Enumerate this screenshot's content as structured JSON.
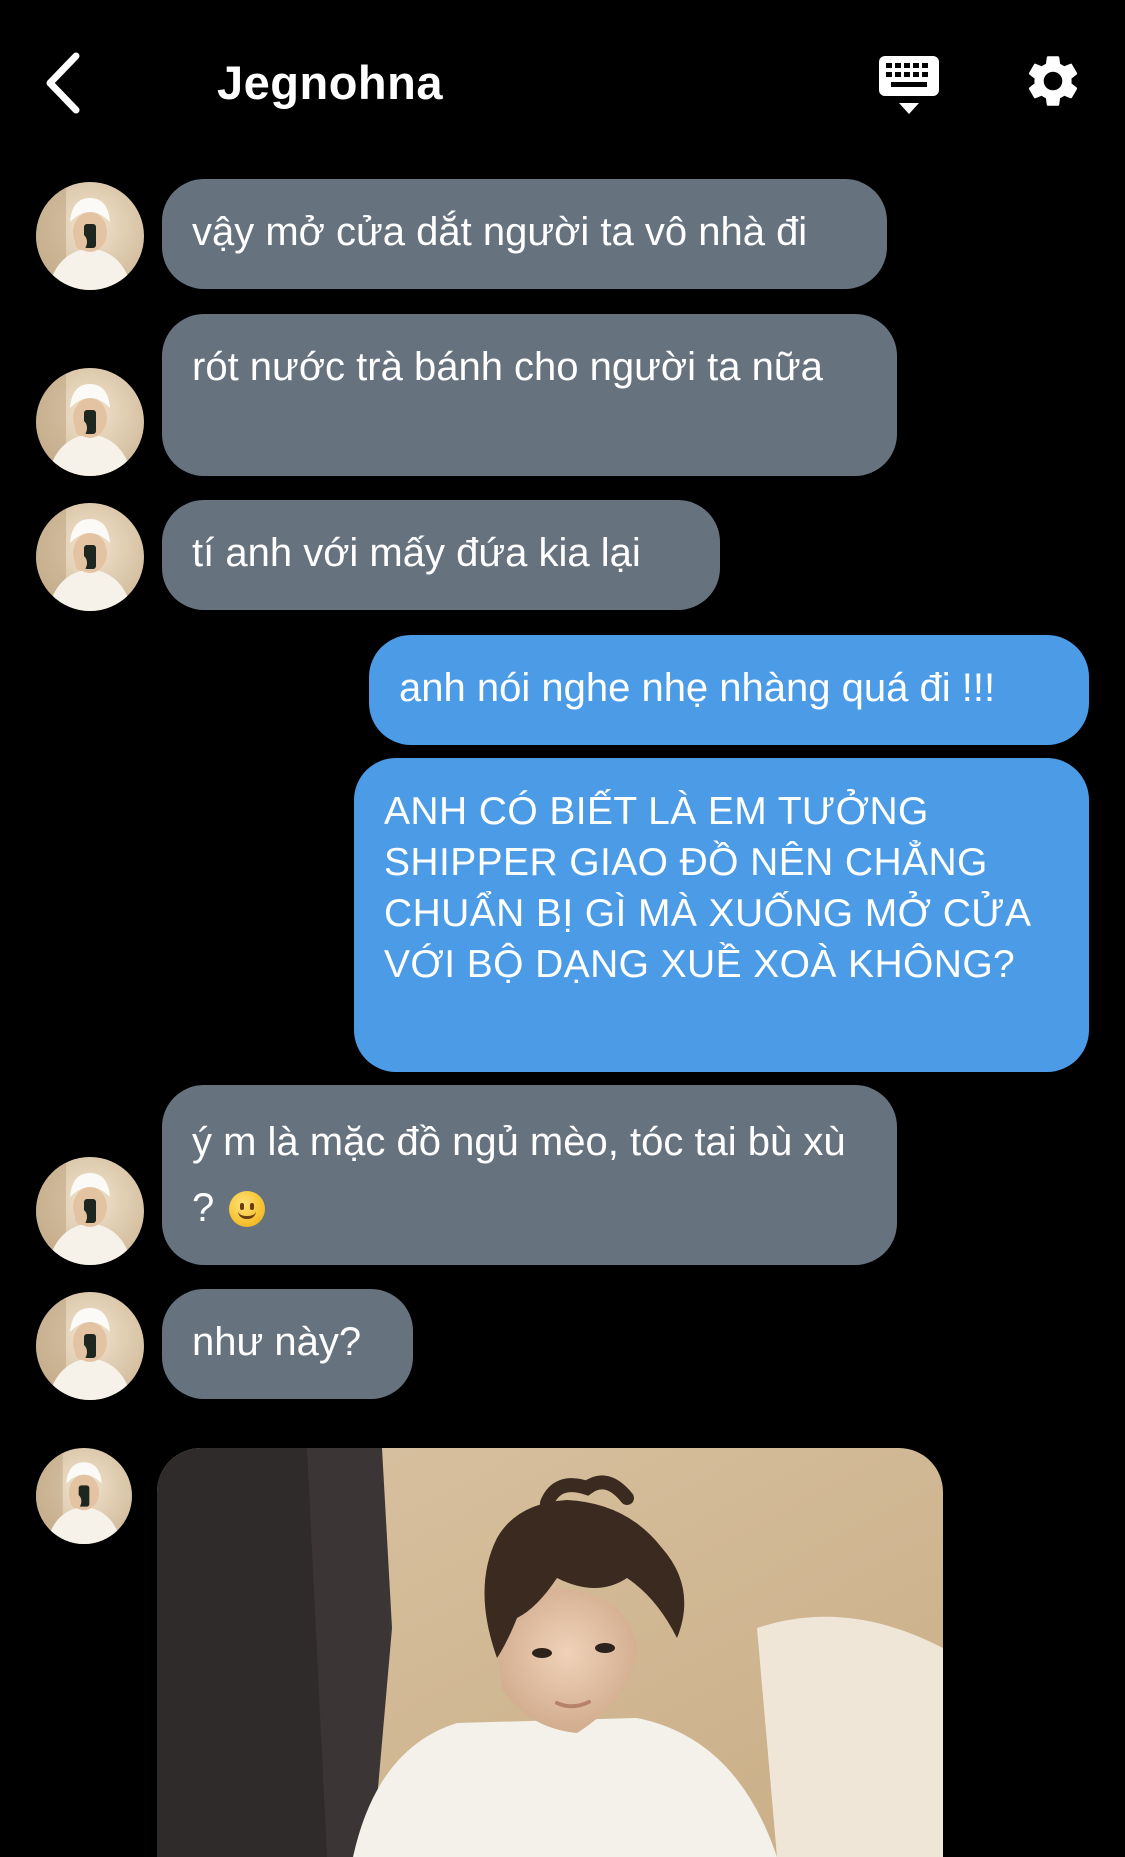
{
  "header": {
    "title": "Jegnohna",
    "back_icon": "chevron-left-icon",
    "keyboard_icon": "keyboard-icon",
    "settings_icon": "gear-icon"
  },
  "colors": {
    "background": "#000000",
    "incoming_bubble": "#66737f",
    "outgoing_bubble": "#4b9be7",
    "text": "#ffffff"
  },
  "messages": [
    {
      "direction": "in",
      "text": "vậy mở cửa dắt người ta vô nhà đi"
    },
    {
      "direction": "in",
      "text": "rót nước trà bánh cho người ta nữa"
    },
    {
      "direction": "in",
      "text": "tí anh với mấy đứa kia lại"
    },
    {
      "direction": "out",
      "text": "anh nói nghe nhẹ nhàng quá đi !!!"
    },
    {
      "direction": "out",
      "text": "ANH CÓ BIẾT LÀ EM TƯỞNG SHIPPER GIAO ĐỒ NÊN CHẲNG CHUẨN BỊ GÌ MÀ XUỐNG MỞ CỬA VỚI BỘ DẠNG XUỀ XOÀ KHÔNG?"
    },
    {
      "direction": "in",
      "text": "ý m là mặc đồ ngủ mèo, tóc tai bù xù ?",
      "emoji": "slightly-smiling-face-icon"
    },
    {
      "direction": "in",
      "text": "như này?"
    },
    {
      "direction": "in",
      "type": "image",
      "icon": "photo-message"
    }
  ]
}
